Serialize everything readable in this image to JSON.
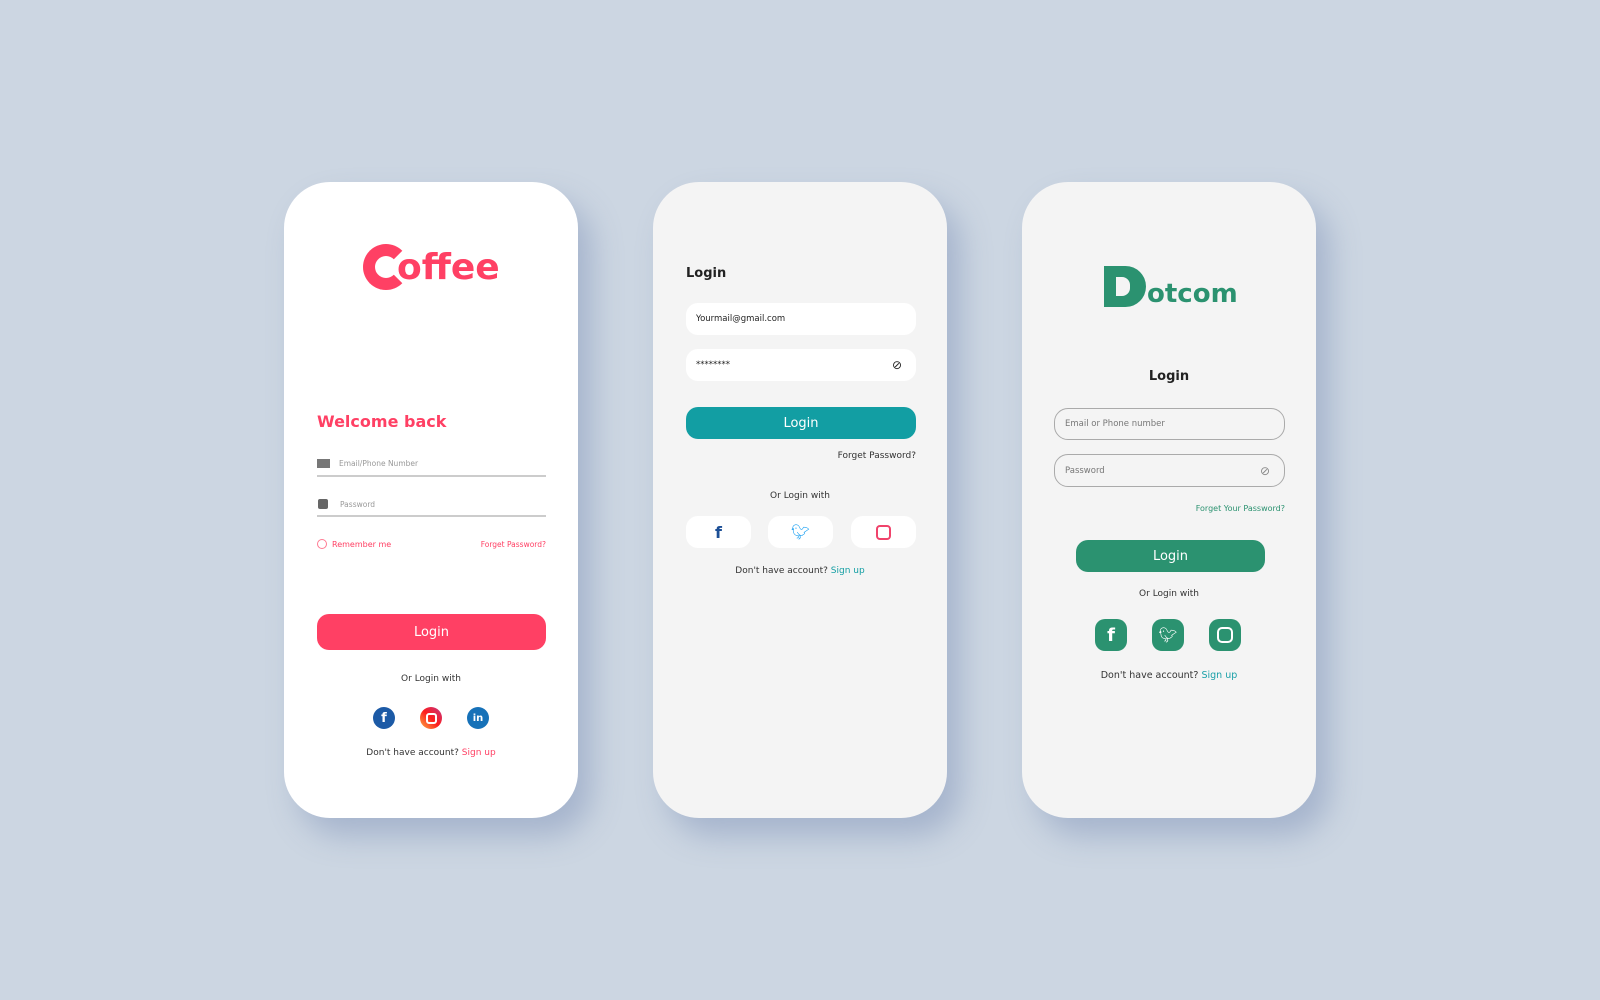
{
  "coffee": {
    "logo": "Coffee",
    "logo_rest": "offee",
    "welcome": "Welcome back",
    "email_placeholder": "Email/Phone Number",
    "password_placeholder": "Password",
    "remember": "Remember me",
    "forgot": "Forget Password?",
    "login": "Login",
    "or_login": "Or Login with",
    "no_account": "Don't have account?",
    "signup": "Sign up",
    "socials": [
      "facebook",
      "instagram",
      "linkedin"
    ],
    "accent": "#ff4064"
  },
  "teal": {
    "title": "Login",
    "email_value": "Yourmail@gmail.com",
    "password_value": "********",
    "login": "Login",
    "forgot": "Forget Password?",
    "or_login": "Or Login with",
    "no_account": "Don't have account?",
    "signup": "Sign up",
    "socials": [
      "facebook",
      "twitter",
      "instagram"
    ],
    "accent": "#129ea3"
  },
  "dotcom": {
    "logo": "Dotcom",
    "logo_rest": "otcom",
    "title": "Login",
    "email_placeholder": "Email or Phone number",
    "password_placeholder": "Password",
    "forgot": "Forget Your Password?",
    "login": "Login",
    "or_login": "Or Login with",
    "no_account": "Don't have account?",
    "signup": "Sign up",
    "socials": [
      "facebook",
      "twitter",
      "instagram"
    ],
    "accent": "#2b9270"
  }
}
